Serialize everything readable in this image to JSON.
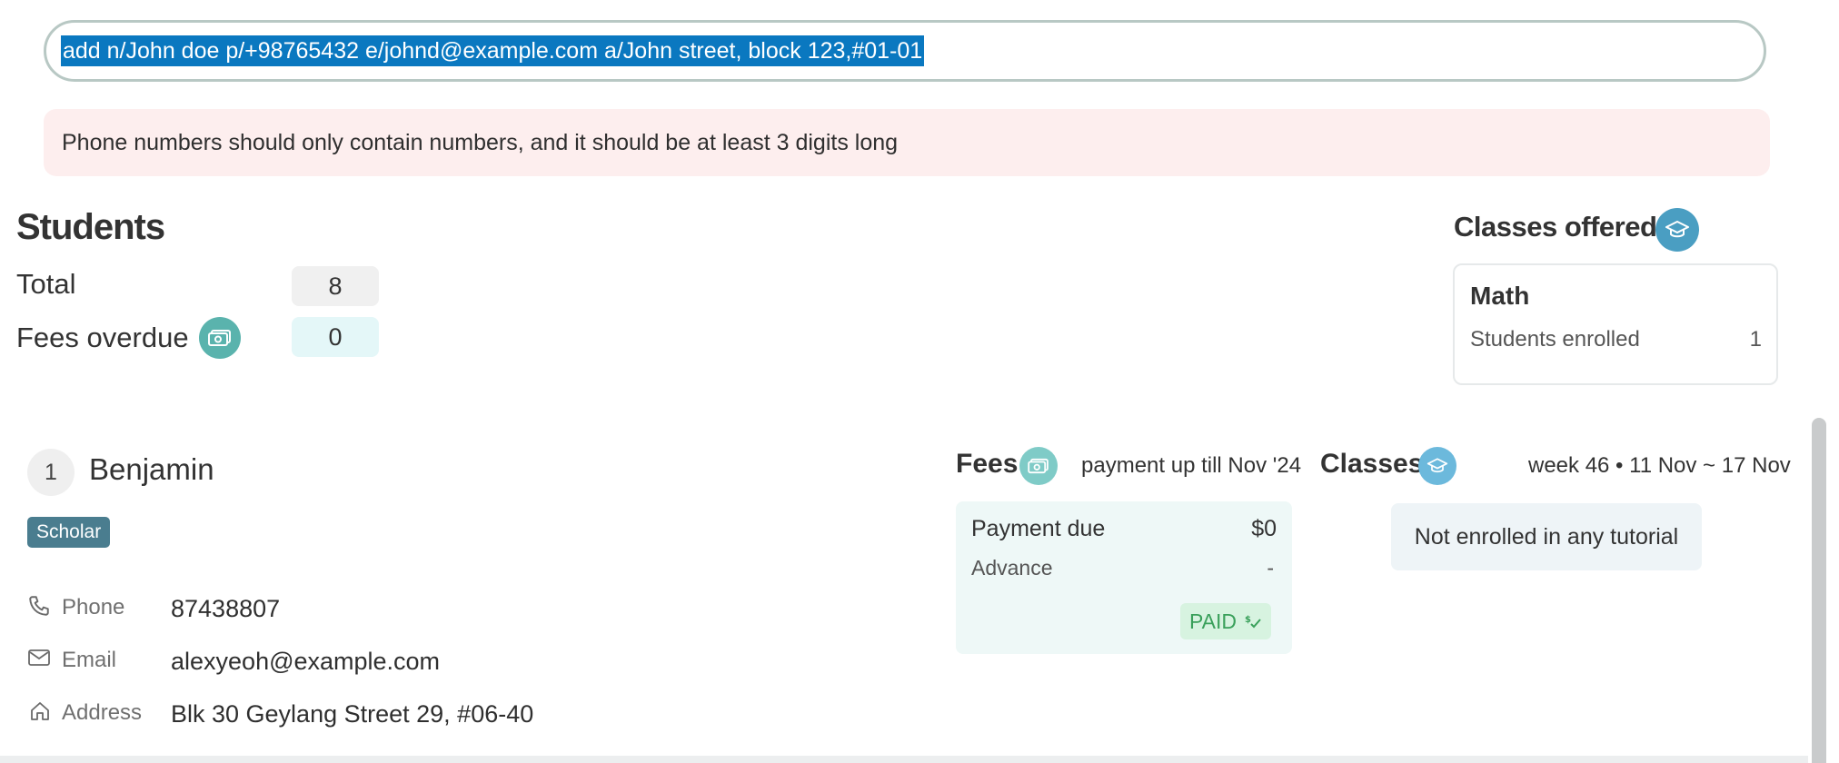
{
  "command": {
    "input_value": "add n/John doe p/+98765432 e/johnd@example.com a/John street, block 123,#01-01"
  },
  "result": {
    "message": "Phone numbers should only contain numbers, and it should be at least 3 digits long"
  },
  "students_summary": {
    "title": "Students",
    "total_label": "Total",
    "total_value": "8",
    "fees_overdue_label": "Fees overdue",
    "fees_overdue_value": "0"
  },
  "classes_offered": {
    "title": "Classes offered",
    "classes": [
      {
        "name": "Math",
        "enrolled_label": "Students enrolled",
        "enrolled_count": "1"
      }
    ]
  },
  "student_card": {
    "index": "1",
    "name": "Benjamin",
    "tag": "Scholar",
    "phone_label": "Phone",
    "phone": "87438807",
    "email_label": "Email",
    "email": "alexyeoh@example.com",
    "address_label": "Address",
    "address": "Blk 30 Geylang Street 29, #06-40",
    "fees": {
      "title": "Fees",
      "subtitle": "payment up till Nov '24",
      "payment_due_label": "Payment due",
      "payment_due": "$0",
      "advance_label": "Advance",
      "advance": "-",
      "status": "PAID"
    },
    "classes": {
      "title": "Classes",
      "week_label": "week 46 • 11 Nov ~ 17 Nov",
      "empty_message": "Not enrolled in any tutorial"
    }
  },
  "icons": {
    "fees_overdue": "money-icon",
    "classes_offered": "graduation-cap-icon",
    "fees": "money-icon",
    "classes": "graduation-cap-icon",
    "phone": "phone-icon",
    "email": "mail-icon",
    "address": "home-icon",
    "paid": "dollar-check-icon"
  },
  "colors": {
    "selection": "#0a78c0",
    "error_background": "#fdeeee",
    "accent_teal": "#5ab3ad",
    "accent_blue": "#4a9ec2",
    "tag": "#4a7d8f",
    "paid": "#3aa05b"
  }
}
